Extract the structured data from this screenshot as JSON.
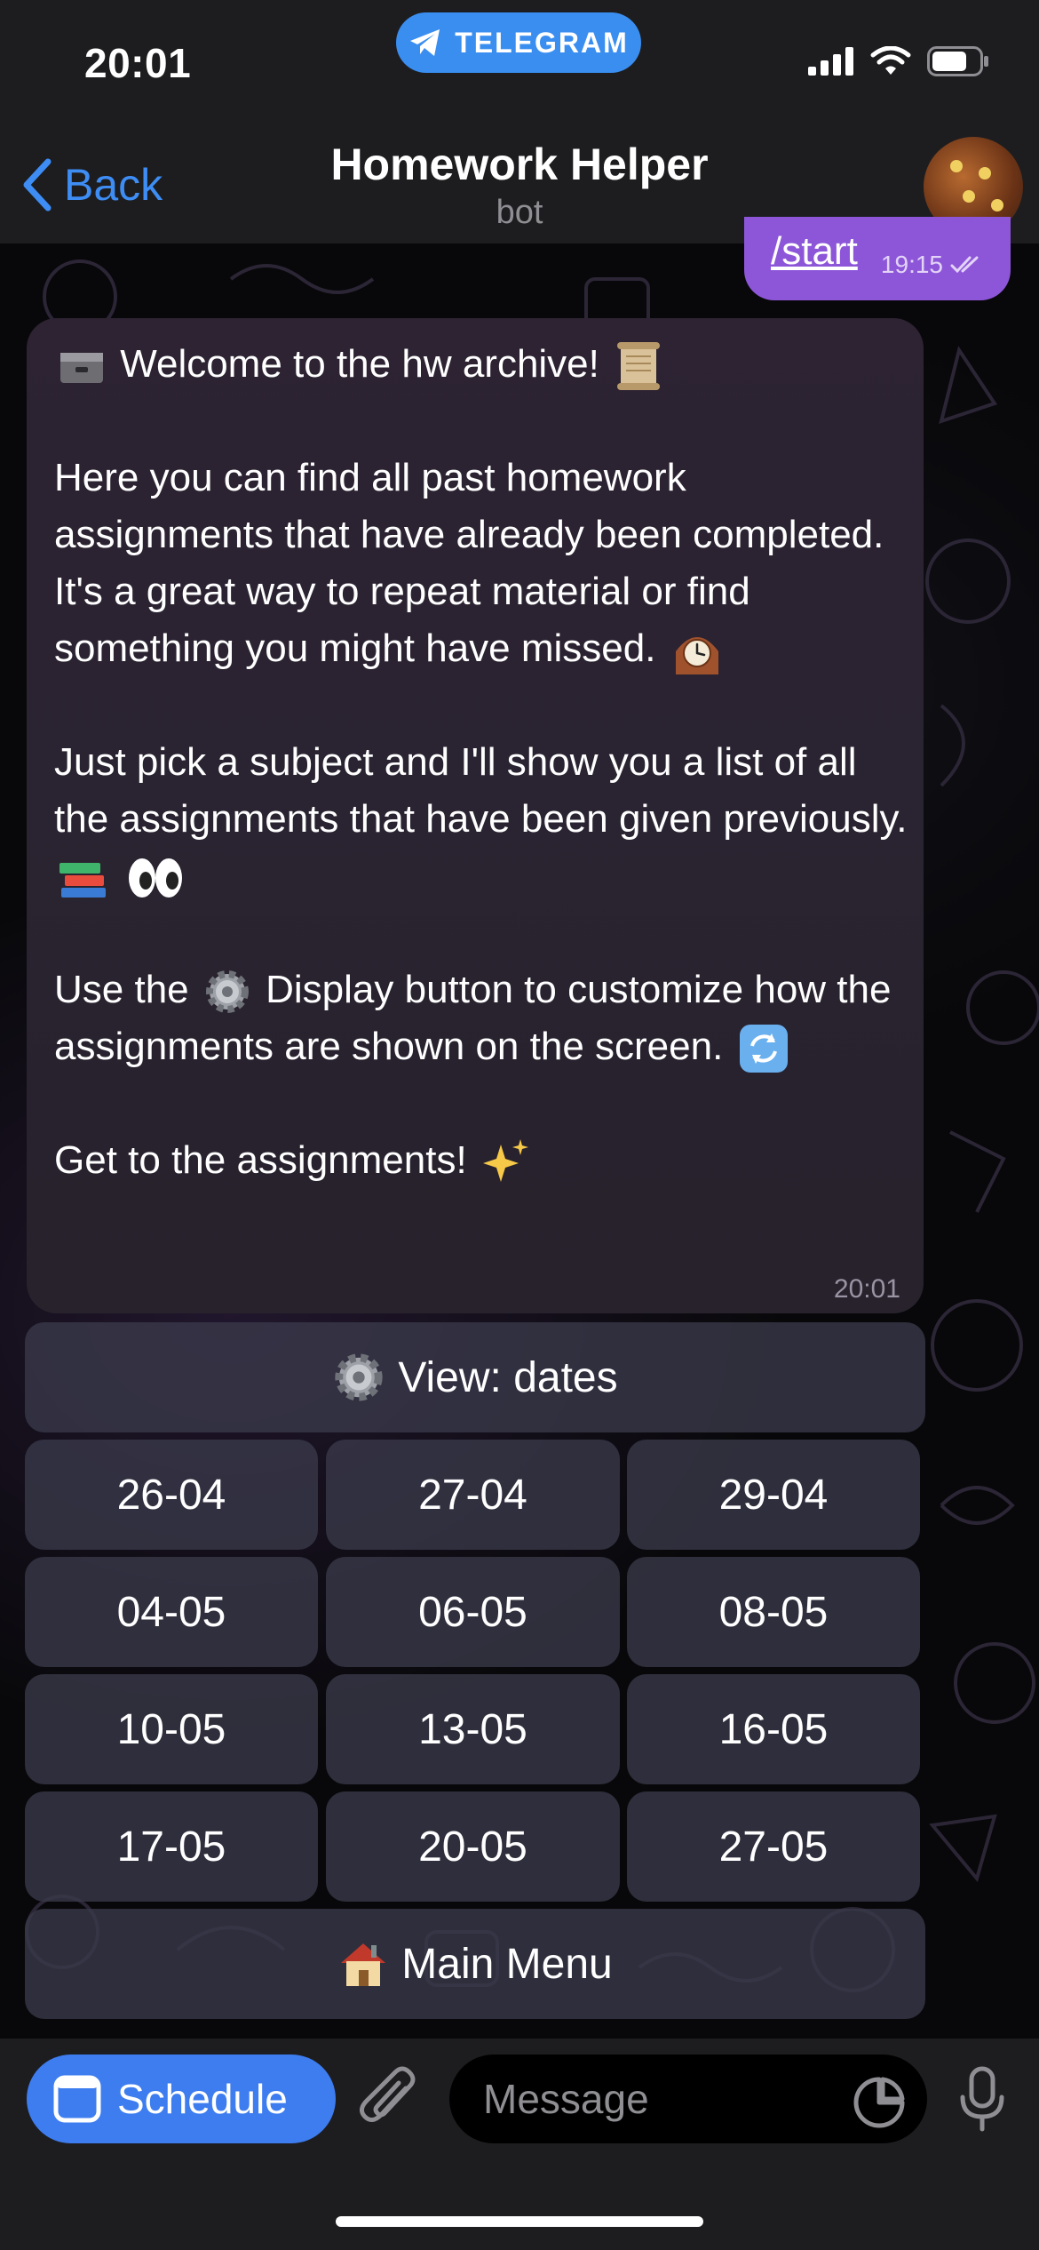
{
  "status_bar": {
    "time": "20:01",
    "app_pill": "TELEGRAM",
    "icons": [
      "signal-icon",
      "wifi-icon",
      "battery-icon"
    ]
  },
  "nav": {
    "back_label": "Back",
    "title": "Homework Helper",
    "subtitle": "bot"
  },
  "outgoing_message": {
    "text": "/start",
    "time": "19:15",
    "status": "read"
  },
  "incoming_message": {
    "line1": "Welcome to the hw archive!",
    "para2": "Here you can find all past homework assignments that have already been completed. It's a great way to repeat material or find something you might have missed.",
    "para3": "Just pick a subject and I'll show you a list of all the assignments that have been given previously.",
    "para4_a": "Use the",
    "para4_b": "Display button to customize how the assignments are shown on the screen.",
    "para5": "Get to the assignments!",
    "time": "20:01"
  },
  "keyboard": {
    "view_label": "View: dates",
    "dates": [
      "26-04",
      "27-04",
      "29-04",
      "04-05",
      "06-05",
      "08-05",
      "10-05",
      "13-05",
      "16-05",
      "17-05",
      "20-05",
      "27-05"
    ],
    "main_menu_label": "Main Menu"
  },
  "composer": {
    "schedule_label": "Schedule",
    "placeholder": "Message"
  },
  "colors": {
    "accent_blue": "#3d8df5",
    "outgoing_bubble": "#8d56d9",
    "telegram_pill": "#3a8ef0"
  }
}
